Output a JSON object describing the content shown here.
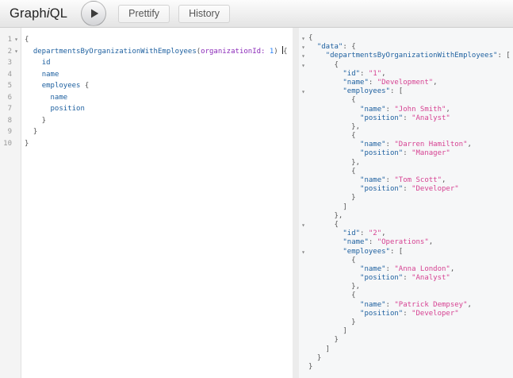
{
  "topbar": {
    "logo_pre": "Graph",
    "logo_i": "i",
    "logo_post": "QL",
    "prettify_label": "Prettify",
    "history_label": "History"
  },
  "icons": {
    "fold_open": "▾",
    "play": "triangle-right"
  },
  "colors": {
    "property": "#1F61A0",
    "attribute": "#8B2BB9",
    "number": "#2882F9",
    "string": "#D64292",
    "punctuation": "#555555",
    "result_background": "#f6f7f8"
  },
  "query_editor": {
    "lines": [
      {
        "num": "1",
        "f": true,
        "t": [
          [
            "p",
            "{"
          ]
        ]
      },
      {
        "num": "2",
        "f": true,
        "t": [
          [
            "p",
            "  "
          ],
          [
            "k",
            "departmentsByOrganizationWithEmployees"
          ],
          [
            "p",
            "("
          ],
          [
            "a",
            "organizationId:"
          ],
          [
            "p",
            " "
          ],
          [
            "n",
            "1"
          ],
          [
            "p",
            ") "
          ],
          [
            "cur",
            ""
          ],
          [
            "p",
            "{"
          ]
        ]
      },
      {
        "num": "3",
        "f": false,
        "t": [
          [
            "p",
            "    "
          ],
          [
            "k",
            "id"
          ]
        ]
      },
      {
        "num": "4",
        "f": false,
        "t": [
          [
            "p",
            "    "
          ],
          [
            "k",
            "name"
          ]
        ]
      },
      {
        "num": "5",
        "f": false,
        "t": [
          [
            "p",
            "    "
          ],
          [
            "k",
            "employees"
          ],
          [
            "p",
            " {"
          ]
        ]
      },
      {
        "num": "6",
        "f": false,
        "t": [
          [
            "p",
            "      "
          ],
          [
            "k",
            "name"
          ]
        ]
      },
      {
        "num": "7",
        "f": false,
        "t": [
          [
            "p",
            "      "
          ],
          [
            "k",
            "position"
          ]
        ]
      },
      {
        "num": "8",
        "f": false,
        "t": [
          [
            "p",
            "    }"
          ]
        ]
      },
      {
        "num": "9",
        "f": false,
        "t": [
          [
            "p",
            "  }"
          ]
        ]
      },
      {
        "num": "10",
        "f": false,
        "t": [
          [
            "p",
            "}"
          ]
        ]
      }
    ]
  },
  "result_viewer": {
    "lines": [
      {
        "f": true,
        "t": [
          [
            "p",
            "{"
          ]
        ]
      },
      {
        "f": true,
        "t": [
          [
            "p",
            "  "
          ],
          [
            "k",
            "\"data\""
          ],
          [
            "p",
            ": {"
          ]
        ]
      },
      {
        "f": true,
        "t": [
          [
            "p",
            "    "
          ],
          [
            "k",
            "\"departmentsByOrganizationWithEmployees\""
          ],
          [
            "p",
            ": ["
          ]
        ]
      },
      {
        "f": true,
        "t": [
          [
            "p",
            "      {"
          ]
        ]
      },
      {
        "f": false,
        "t": [
          [
            "p",
            "        "
          ],
          [
            "k",
            "\"id\""
          ],
          [
            "p",
            ": "
          ],
          [
            "s",
            "\"1\""
          ],
          [
            "p",
            ","
          ]
        ]
      },
      {
        "f": false,
        "t": [
          [
            "p",
            "        "
          ],
          [
            "k",
            "\"name\""
          ],
          [
            "p",
            ": "
          ],
          [
            "s",
            "\"Development\""
          ],
          [
            "p",
            ","
          ]
        ]
      },
      {
        "f": true,
        "t": [
          [
            "p",
            "        "
          ],
          [
            "k",
            "\"employees\""
          ],
          [
            "p",
            ": ["
          ]
        ]
      },
      {
        "f": false,
        "t": [
          [
            "p",
            "          {"
          ]
        ]
      },
      {
        "f": false,
        "t": [
          [
            "p",
            "            "
          ],
          [
            "k",
            "\"name\""
          ],
          [
            "p",
            ": "
          ],
          [
            "s",
            "\"John Smith\""
          ],
          [
            "p",
            ","
          ]
        ]
      },
      {
        "f": false,
        "t": [
          [
            "p",
            "            "
          ],
          [
            "k",
            "\"position\""
          ],
          [
            "p",
            ": "
          ],
          [
            "s",
            "\"Analyst\""
          ]
        ]
      },
      {
        "f": false,
        "t": [
          [
            "p",
            "          },"
          ]
        ]
      },
      {
        "f": false,
        "t": [
          [
            "p",
            "          {"
          ]
        ]
      },
      {
        "f": false,
        "t": [
          [
            "p",
            "            "
          ],
          [
            "k",
            "\"name\""
          ],
          [
            "p",
            ": "
          ],
          [
            "s",
            "\"Darren Hamilton\""
          ],
          [
            "p",
            ","
          ]
        ]
      },
      {
        "f": false,
        "t": [
          [
            "p",
            "            "
          ],
          [
            "k",
            "\"position\""
          ],
          [
            "p",
            ": "
          ],
          [
            "s",
            "\"Manager\""
          ]
        ]
      },
      {
        "f": false,
        "t": [
          [
            "p",
            "          },"
          ]
        ]
      },
      {
        "f": false,
        "t": [
          [
            "p",
            "          {"
          ]
        ]
      },
      {
        "f": false,
        "t": [
          [
            "p",
            "            "
          ],
          [
            "k",
            "\"name\""
          ],
          [
            "p",
            ": "
          ],
          [
            "s",
            "\"Tom Scott\""
          ],
          [
            "p",
            ","
          ]
        ]
      },
      {
        "f": false,
        "t": [
          [
            "p",
            "            "
          ],
          [
            "k",
            "\"position\""
          ],
          [
            "p",
            ": "
          ],
          [
            "s",
            "\"Developer\""
          ]
        ]
      },
      {
        "f": false,
        "t": [
          [
            "p",
            "          }"
          ]
        ]
      },
      {
        "f": false,
        "t": [
          [
            "p",
            "        ]"
          ]
        ]
      },
      {
        "f": false,
        "t": [
          [
            "p",
            "      },"
          ]
        ]
      },
      {
        "f": true,
        "t": [
          [
            "p",
            "      {"
          ]
        ]
      },
      {
        "f": false,
        "t": [
          [
            "p",
            "        "
          ],
          [
            "k",
            "\"id\""
          ],
          [
            "p",
            ": "
          ],
          [
            "s",
            "\"2\""
          ],
          [
            "p",
            ","
          ]
        ]
      },
      {
        "f": false,
        "t": [
          [
            "p",
            "        "
          ],
          [
            "k",
            "\"name\""
          ],
          [
            "p",
            ": "
          ],
          [
            "s",
            "\"Operations\""
          ],
          [
            "p",
            ","
          ]
        ]
      },
      {
        "f": true,
        "t": [
          [
            "p",
            "        "
          ],
          [
            "k",
            "\"employees\""
          ],
          [
            "p",
            ": ["
          ]
        ]
      },
      {
        "f": false,
        "t": [
          [
            "p",
            "          {"
          ]
        ]
      },
      {
        "f": false,
        "t": [
          [
            "p",
            "            "
          ],
          [
            "k",
            "\"name\""
          ],
          [
            "p",
            ": "
          ],
          [
            "s",
            "\"Anna London\""
          ],
          [
            "p",
            ","
          ]
        ]
      },
      {
        "f": false,
        "t": [
          [
            "p",
            "            "
          ],
          [
            "k",
            "\"position\""
          ],
          [
            "p",
            ": "
          ],
          [
            "s",
            "\"Analyst\""
          ]
        ]
      },
      {
        "f": false,
        "t": [
          [
            "p",
            "          },"
          ]
        ]
      },
      {
        "f": false,
        "t": [
          [
            "p",
            "          {"
          ]
        ]
      },
      {
        "f": false,
        "t": [
          [
            "p",
            "            "
          ],
          [
            "k",
            "\"name\""
          ],
          [
            "p",
            ": "
          ],
          [
            "s",
            "\"Patrick Dempsey\""
          ],
          [
            "p",
            ","
          ]
        ]
      },
      {
        "f": false,
        "t": [
          [
            "p",
            "            "
          ],
          [
            "k",
            "\"position\""
          ],
          [
            "p",
            ": "
          ],
          [
            "s",
            "\"Developer\""
          ]
        ]
      },
      {
        "f": false,
        "t": [
          [
            "p",
            "          }"
          ]
        ]
      },
      {
        "f": false,
        "t": [
          [
            "p",
            "        ]"
          ]
        ]
      },
      {
        "f": false,
        "t": [
          [
            "p",
            "      }"
          ]
        ]
      },
      {
        "f": false,
        "t": [
          [
            "p",
            "    ]"
          ]
        ]
      },
      {
        "f": false,
        "t": [
          [
            "p",
            "  }"
          ]
        ]
      },
      {
        "f": false,
        "t": [
          [
            "p",
            "}"
          ]
        ]
      }
    ]
  }
}
